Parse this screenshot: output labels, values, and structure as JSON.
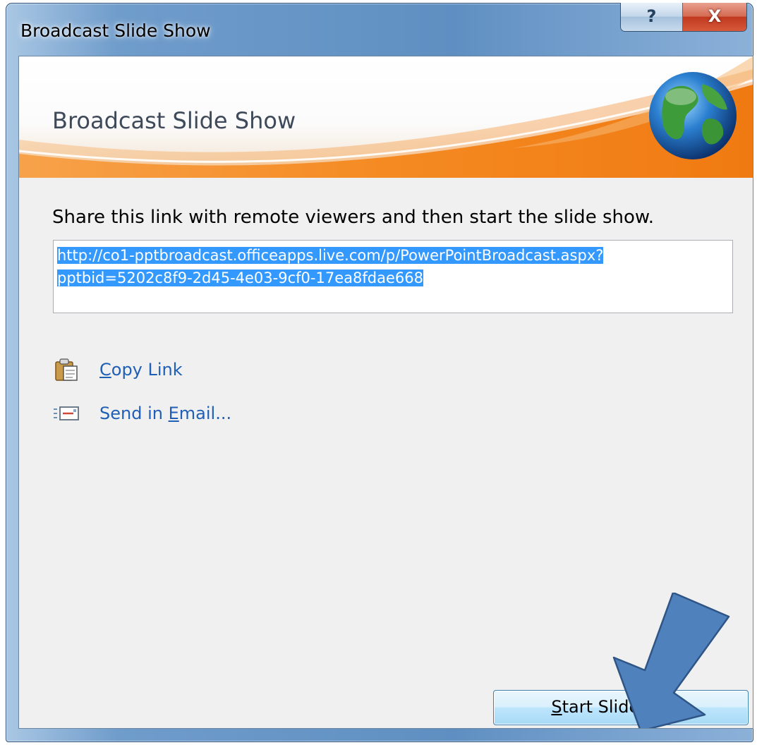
{
  "window": {
    "title": "Broadcast Slide Show",
    "help_label": "?",
    "close_label": "X"
  },
  "banner": {
    "title": "Broadcast Slide Show",
    "icon": "globe-icon"
  },
  "main": {
    "instruction": "Share this link with remote viewers and then start the slide show.",
    "link_line1": "http://co1-pptbroadcast.officeapps.live.com/p/PowerPointBroadcast.aspx?",
    "link_line2": "pptbid=5202c8f9-2d45-4e03-9cf0-17ea8fdae668"
  },
  "actions": {
    "copy_link": {
      "accel": "C",
      "rest": "opy Link",
      "icon": "clipboard-icon"
    },
    "send_email": {
      "before": "Send in ",
      "accel": "E",
      "after": "mail...",
      "icon": "email-icon"
    }
  },
  "footer": {
    "start_accel": "S",
    "start_rest": "tart Slide Show"
  },
  "annotation": {
    "icon": "arrow-icon",
    "color": "#4f81bd"
  },
  "colors": {
    "link_selection": "#3399ff",
    "banner_orange": "#f5861f",
    "link_text": "#1f5fb5"
  }
}
